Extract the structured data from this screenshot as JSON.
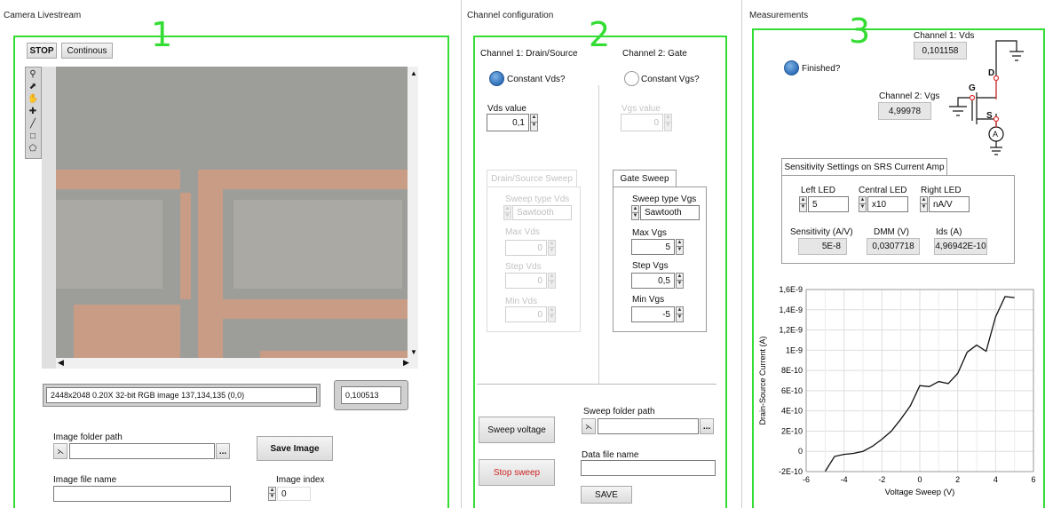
{
  "camera": {
    "title": "Camera Livestream",
    "stop_label": "STOP",
    "continuous_label": "Continous",
    "image_info": "2448x2048 0.20X 32-bit RGB image 137,134,135    (0,0)",
    "value_display": "0,100513",
    "folder_path_label": "Image folder path",
    "folder_path_value": "",
    "browse_label": "...",
    "save_image_label": "Save Image",
    "file_name_label": "Image file name",
    "file_name_value": "",
    "index_label": "Image index",
    "index_value": "0"
  },
  "channel": {
    "title": "Channel configuration",
    "ch1_title": "Channel 1: Drain/Source",
    "ch2_title": "Channel 2: Gate",
    "const_vds_label": "Constant Vds?",
    "const_vgs_label": "Constant Vgs?",
    "vds_value_label": "Vds value",
    "vds_value": "0,1",
    "vgs_value_label": "Vgs value",
    "vgs_value": "0",
    "ds_sweep_tab": "Drain/Source Sweep",
    "sweep_type_vds_label": "Sweep type Vds",
    "sweep_type_vds_value": "Sawtooth",
    "max_vds_label": "Max Vds",
    "max_vds_value": "0",
    "step_vds_label": "Step Vds",
    "step_vds_value": "0",
    "min_vds_label": "Min Vds",
    "min_vds_value": "0",
    "gate_sweep_tab": "Gate Sweep",
    "sweep_type_vgs_label": "Sweep type Vgs",
    "sweep_type_vgs_value": "Sawtooth",
    "max_vgs_label": "Max Vgs",
    "max_vgs_value": "5",
    "step_vgs_label": "Step Vgs",
    "step_vgs_value": "0,5",
    "min_vgs_label": "Min Vgs",
    "min_vgs_value": "-5",
    "sweep_voltage_label": "Sweep voltage",
    "stop_sweep_label": "Stop sweep",
    "sweep_folder_label": "Sweep folder path",
    "sweep_folder_value": "",
    "browse_label": "...",
    "data_file_label": "Data file name",
    "data_file_value": "",
    "save_label": "SAVE"
  },
  "measurements": {
    "title": "Measurements",
    "finished_label": "Finished?",
    "ch1_vds_label": "Channel 1: Vds",
    "ch1_vds_value": "0,101158",
    "ch2_vgs_label": "Channel 2: Vgs",
    "ch2_vgs_value": "4,99978",
    "circuit_d": "D",
    "circuit_g": "G",
    "circuit_s": "S",
    "circuit_a": "A",
    "sens_tab": "Sensitivity Settings on SRS Current Amp",
    "left_led_label": "Left LED",
    "left_led_value": "5",
    "central_led_label": "Central LED",
    "central_led_value": "x10",
    "right_led_label": "Right LED",
    "right_led_value": "nA/V",
    "sensitivity_label": "Sensitivity (A/V)",
    "sensitivity_value": "5E-8",
    "dmm_label": "DMM (V)",
    "dmm_value": "0,0307718",
    "ids_label": "Ids (A)",
    "ids_value": "4,96942E-10"
  },
  "section_numbers": [
    "1",
    "2",
    "3"
  ],
  "colors": {
    "frame": "#33dd33",
    "led_on": "#2e6fb8",
    "stop_sweep_text": "#cc2222",
    "circuit_red": "#e03030"
  },
  "chart_data": {
    "type": "line",
    "xlabel": "Voltage Sweep (V)",
    "ylabel": "Drain-Source Current (A)",
    "xlim": [
      -6,
      6
    ],
    "ylim": [
      -2e-10,
      1.6e-09
    ],
    "x_ticks": [
      "-6",
      "-4",
      "-2",
      "0",
      "2",
      "4",
      "6"
    ],
    "y_ticks": [
      "-2E-10",
      "0",
      "2E-10",
      "4E-10",
      "6E-10",
      "8E-10",
      "1E-9",
      "1,2E-9",
      "1,4E-9",
      "1,6E-9"
    ],
    "grid": true,
    "series": [
      {
        "x": [
          -5,
          -4.5,
          -4,
          -3.5,
          -3,
          -2.5,
          -2,
          -1.5,
          -1,
          -0.5,
          0,
          0.5,
          1,
          1.5,
          2,
          2.5,
          3,
          3.5,
          4,
          4.5,
          5
        ],
        "y": [
          -2e-10,
          -5e-11,
          -3e-11,
          -2e-11,
          0,
          5e-11,
          1.2e-10,
          2e-10,
          3.2e-10,
          4.5e-10,
          6.5e-10,
          6.4e-10,
          6.9e-10,
          6.7e-10,
          7.7e-10,
          9.8e-10,
          1.05e-09,
          9.9e-10,
          1.33e-09,
          1.53e-09,
          1.52e-09
        ]
      }
    ]
  }
}
